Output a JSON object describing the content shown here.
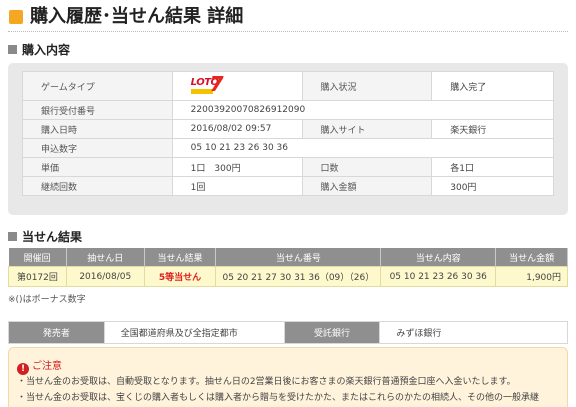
{
  "page": {
    "title": "購入履歴･当せん結果 詳細"
  },
  "purchase_section": {
    "heading": "購入内容",
    "rows": [
      {
        "l1": "ゲームタイプ",
        "v1_logo": "LOTO7",
        "l2": "購入状況",
        "v2": "購入完了"
      },
      {
        "l1": "銀行受付番号",
        "v1": "22003920070826912090",
        "l2": "",
        "v2": ""
      },
      {
        "l1": "購入日時",
        "v1": "2016/08/02 09:57",
        "l2": "購入サイト",
        "v2": "楽天銀行"
      },
      {
        "l1": "申込数字",
        "v1": "05 10 21 23 26 30 36",
        "l2": "",
        "v2": ""
      },
      {
        "l1": "単価",
        "v1": "1口　300円",
        "l2": "口数",
        "v2": "各1口"
      },
      {
        "l1": "継続回数",
        "v1": "1回",
        "l2": "購入金額",
        "v2": "300円"
      }
    ]
  },
  "results_section": {
    "heading": "当せん結果",
    "columns": [
      "開催回",
      "抽せん日",
      "当せん結果",
      "当せん番号",
      "当せん内容",
      "当せん金額"
    ],
    "rows": [
      {
        "round": "第0172回",
        "date": "2016/08/05",
        "result": "5等当せん",
        "numbers": "05 20 21 27 30 31 36（09）（26）",
        "content": "05 10 21 23 26 30 36",
        "amount": "1,900円"
      }
    ],
    "note": "※()はボーナス数字"
  },
  "issuer_info": {
    "issuer_label": "発売者",
    "issuer_value": "全国都道府県及び全指定都市",
    "bank_label": "受託銀行",
    "bank_value": "みずほ銀行"
  },
  "notice": {
    "title": "ご注意",
    "lines": [
      "・当せん金のお受取は、自動受取となります。抽せん日の2営業日後にお客さまの楽天銀行普通預金口座へ入金いたします。",
      "・当せん金のお受取は、宝くじの購入者もしくは購入者から贈与を受けたかた、またはこれらのかたの相続人、その他の一般承継"
    ]
  },
  "colors": {
    "accent": "#f5a623",
    "header_gray": "#8f8f8f",
    "result_row_bg": "#fdf9cc",
    "prize_red": "#e02020",
    "notice_bg": "#fff3dc"
  }
}
